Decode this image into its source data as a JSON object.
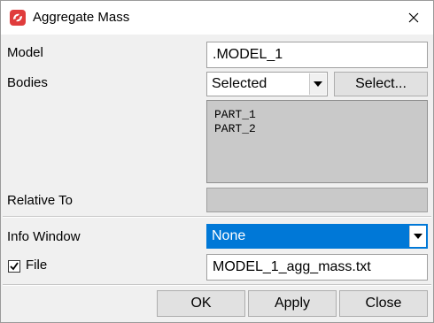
{
  "window": {
    "title": "Aggregate Mass"
  },
  "form": {
    "model": {
      "label": "Model",
      "value": ".MODEL_1"
    },
    "bodies": {
      "label": "Bodies",
      "selected": "Selected",
      "select_button": "Select...",
      "items": [
        "PART_1",
        "PART_2"
      ]
    },
    "relative_to": {
      "label": "Relative To",
      "value": ""
    },
    "info_window": {
      "label": "Info Window",
      "selected": "None"
    },
    "file": {
      "label": "File",
      "checked": true,
      "value": "MODEL_1_agg_mass.txt"
    }
  },
  "buttons": {
    "ok": "OK",
    "apply": "Apply",
    "close": "Close"
  },
  "colors": {
    "selection": "#0078d7",
    "app_icon": "#e03c3c",
    "disabled_field": "#c9c9c9"
  }
}
